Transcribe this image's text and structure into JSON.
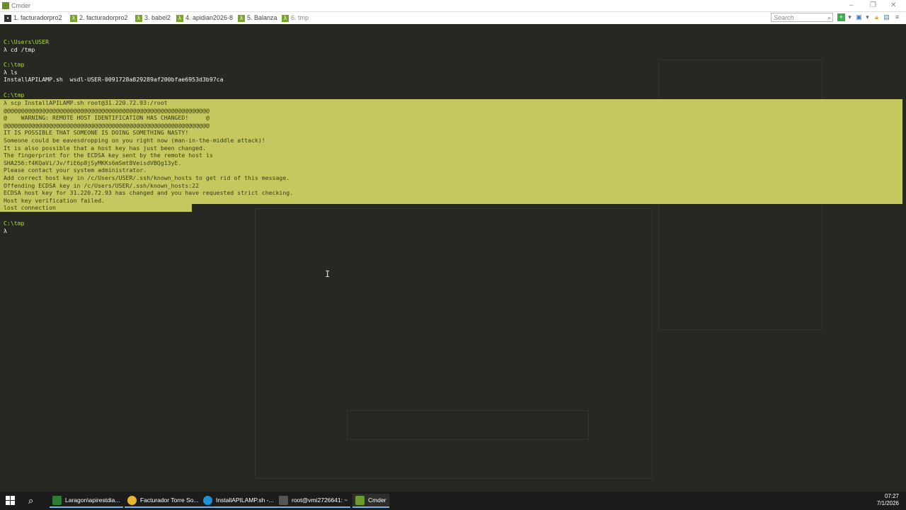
{
  "window": {
    "title": "Cmder"
  },
  "tabs": [
    {
      "label": "1. facturadorpro2",
      "icon": "cmd-icon"
    },
    {
      "label": "2. facturadorpro2",
      "icon": "lambda-icon"
    },
    {
      "label": "3. babel2",
      "icon": "lambda-icon"
    },
    {
      "label": "4. apidian2026-8",
      "icon": "lambda-icon"
    },
    {
      "label": "5. Balanza",
      "icon": "lambda-icon"
    },
    {
      "label": "6. tmp",
      "icon": "lambda-icon"
    }
  ],
  "search": {
    "placeholder": "Search"
  },
  "terminal": {
    "lines": [
      {
        "text": "C:\\Users\\USER",
        "kind": "prompt"
      },
      {
        "text": "λ cd /tmp",
        "kind": "cmd"
      },
      {
        "text": "",
        "kind": "blank"
      },
      {
        "text": "C:\\tmp",
        "kind": "prompt"
      },
      {
        "text": "λ ls",
        "kind": "cmd"
      },
      {
        "text": "InstallAPILAMP.sh  wsdl-USER-0091728a829289af200bfae6953d3b97ca",
        "kind": "out"
      },
      {
        "text": "",
        "kind": "blank"
      },
      {
        "text": "C:\\tmp",
        "kind": "prompt"
      }
    ],
    "selected": [
      "λ scp InstallAPILAMP.sh root@31.220.72.93:/root",
      "@@@@@@@@@@@@@@@@@@@@@@@@@@@@@@@@@@@@@@@@@@@@@@@@@@@@@@@@@@@",
      "@    WARNING: REMOTE HOST IDENTIFICATION HAS CHANGED!     @",
      "@@@@@@@@@@@@@@@@@@@@@@@@@@@@@@@@@@@@@@@@@@@@@@@@@@@@@@@@@@@",
      "IT IS POSSIBLE THAT SOMEONE IS DOING SOMETHING NASTY!",
      "Someone could be eavesdropping on you right now (man-in-the-middle attack)!",
      "It is also possible that a host key has just been changed.",
      "The fingerprint for the ECDSA key sent by the remote host is",
      "SHA256:f4KQaVi/Jv/fiE6p8jSyMKKs6mSmt8VeisdVBQg13yE.",
      "Please contact your system administrator.",
      "Add correct host key in /c/Users/USER/.ssh/known_hosts to get rid of this message.",
      "Offending ECDSA key in /c/Users/USER/.ssh/known_hosts:22",
      "ECDSA host key for 31.220.72.93 has changed and you have requested strict checking.",
      "Host key verification failed.",
      "lost connection"
    ],
    "after": [
      {
        "text": "C:\\tmp",
        "kind": "prompt"
      },
      {
        "text": "λ",
        "kind": "cmd"
      }
    ]
  },
  "taskbar": {
    "items": [
      {
        "label": "Laragon\\apirestdia...",
        "color": "#2f7d32"
      },
      {
        "label": "Facturador Torre So...",
        "color": "#e8b730"
      },
      {
        "label": "InstallAPILAMP.sh -...",
        "color": "#1f8fd6"
      },
      {
        "label": "root@vmi2726641: ~",
        "color": "#555555"
      },
      {
        "label": "Cmder",
        "color": "#6a9b2c"
      }
    ],
    "time": "07:27",
    "date": "7/1/2026"
  }
}
